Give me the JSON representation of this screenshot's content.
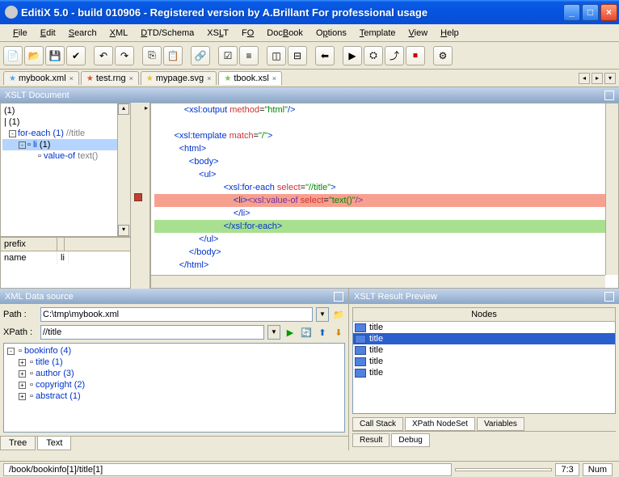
{
  "window": {
    "title": "EditiX 5.0 - build 010906 - Registered version by A.Brillant For professional usage"
  },
  "menu": {
    "file": "File",
    "edit": "Edit",
    "search": "Search",
    "xml": "XML",
    "dtd": "DTD/Schema",
    "xslt": "XSLT",
    "fo": "FO",
    "docbook": "DocBook",
    "options": "Options",
    "template": "Template",
    "view": "View",
    "help": "Help"
  },
  "filetabs": [
    {
      "label": "mybook.xml",
      "color": "#4aa8ff"
    },
    {
      "label": "test.rng",
      "color": "#e05030"
    },
    {
      "label": "mypage.svg",
      "color": "#f0c020"
    },
    {
      "label": "tbook.xsl",
      "color": "#80c050",
      "active": true
    }
  ],
  "panels": {
    "xsltDoc": "XSLT Document",
    "dataSrc": "XML Data source",
    "resultPrev": "XSLT Result Preview"
  },
  "outline": {
    "r0": "(1)",
    "r1": "| (1)",
    "r2_a": "for-each (1) ",
    "r2_b": "//title",
    "r3_a": "li ",
    "r3_b": "(1)",
    "r4_a": "value-of ",
    "r4_b": "text()"
  },
  "prefixGrid": {
    "h0": "prefix",
    "h1": " ",
    "c0": "name",
    "c1": "li"
  },
  "code": {
    "l0a": "<xsl:output",
    "l0b": " method",
    "l0c": "=",
    "l0d": "\"html\"",
    "l0e": "/>",
    "l1a": "<xsl:template",
    "l1b": " match",
    "l1c": "=",
    "l1d": "\"/\"",
    "l1e": ">",
    "l2": "<html>",
    "l3": "<body>",
    "l4": "<ul>",
    "l5a": "<xsl:for-each",
    "l5b": " select",
    "l5c": "=",
    "l5d": "\"//title\"",
    "l5e": ">",
    "l6a": "<li>",
    "l6b": "<xsl:value-of",
    "l6c": " select",
    "l6d": "=",
    "l6e": "\"text()\"",
    "l6f": "/>",
    "l7": "</li>",
    "l8": "</xsl:for-each>",
    "l9": "</ul>",
    "l10": "</body>",
    "l11": "</html>"
  },
  "datasource": {
    "pathLabel": "Path :",
    "pathValue": "C:\\tmp\\mybook.xml",
    "xpathLabel": "XPath :",
    "xpathValue": "//title",
    "tree": {
      "root": "bookinfo (4)",
      "n0": "title (1)",
      "n1": "author (3)",
      "n2": "copyright (2)",
      "n3": "abstract (1)"
    },
    "tabs": {
      "tree": "Tree",
      "text": "Text"
    }
  },
  "result": {
    "nodesHeader": "Nodes",
    "rows": [
      "title",
      "title",
      "title",
      "title",
      "title"
    ],
    "tabs1": {
      "cs": "Call Stack",
      "xn": "XPath NodeSet",
      "vr": "Variables"
    },
    "tabs2": {
      "res": "Result",
      "dbg": "Debug"
    }
  },
  "status": {
    "path": "/book/bookinfo[1]/title[1]",
    "pos": "7:3",
    "num": "Num"
  }
}
